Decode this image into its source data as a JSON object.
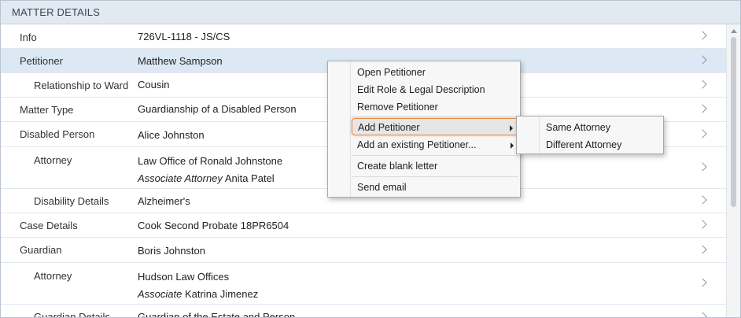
{
  "panel": {
    "title": "MATTER DETAILS"
  },
  "rows": [
    {
      "label": "Info",
      "value1": "726VL-1118 - JS/CS"
    },
    {
      "label": "Petitioner",
      "value1": "Matthew Sampson"
    },
    {
      "label": "Relationship to Ward",
      "value1": "Cousin"
    },
    {
      "label": "Matter Type",
      "value1": "Guardianship of a Disabled Person"
    },
    {
      "label": "Disabled Person",
      "value1": "Alice Johnston"
    },
    {
      "label": "Attorney",
      "value1": "Law Office of Ronald Johnstone",
      "value2_role": "Associate Attorney",
      "value2_name": "Anita Patel"
    },
    {
      "label": "Disability Details",
      "value1": "Alzheimer's"
    },
    {
      "label": "Case Details",
      "value1": "Cook Second Probate 18PR6504"
    },
    {
      "label": "Guardian",
      "value1": "Boris Johnston"
    },
    {
      "label": "Attorney",
      "value1": "Hudson Law Offices",
      "value2_role": "Associate",
      "value2_name": "Katrina Jimenez"
    },
    {
      "label": "Guardian Details",
      "value1": "Guardian of the Estate and Person"
    }
  ],
  "context_menu": {
    "items": [
      "Open Petitioner",
      "Edit Role & Legal Description",
      "Remove Petitioner",
      "Add Petitioner",
      "Add an existing Petitioner...",
      "Create blank letter",
      "Send email"
    ]
  },
  "submenu": {
    "items": [
      "Same Attorney",
      "Different Attorney"
    ]
  }
}
